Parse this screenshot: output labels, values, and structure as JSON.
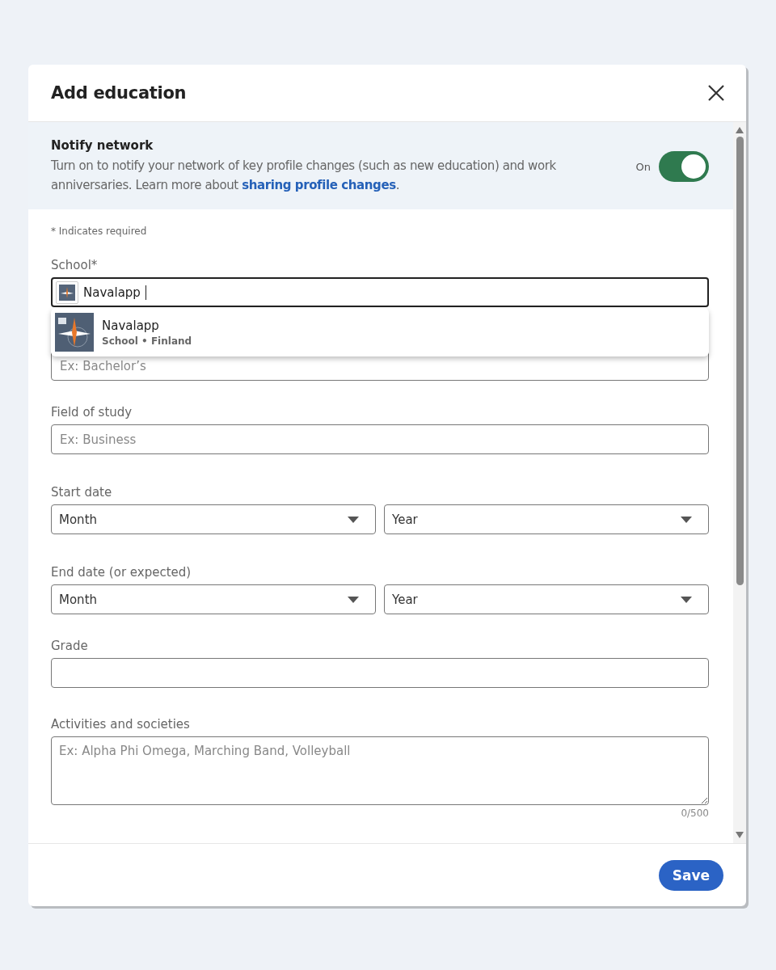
{
  "dialog": {
    "title": "Add education"
  },
  "notify": {
    "title": "Notify network",
    "text": "Turn on to notify your network of key profile changes (such as new education) and work anniversaries. Learn more about ",
    "link": "sharing profile changes",
    "after": ".",
    "toggle_label": "On",
    "on": true
  },
  "required_note": "* Indicates required",
  "fields": [
    {
      "kind": "school",
      "label": "School*",
      "value": "Navalapp"
    },
    {
      "kind": "text",
      "placeholder": "Ex: Bachelor’s"
    },
    {
      "kind": "text",
      "label": "Field of study",
      "placeholder": "Ex: Business"
    },
    {
      "kind": "dates",
      "label": "Start date",
      "selects": [
        "Month",
        "Year"
      ]
    },
    {
      "kind": "dates",
      "label": "End date (or expected)",
      "selects": [
        "Month",
        "Year"
      ]
    },
    {
      "kind": "text",
      "label": "Grade"
    },
    {
      "kind": "textarea",
      "label": "Activities and societies",
      "placeholder": "Ex: Alpha Phi Omega, Marching Band, Volleyball",
      "counter": "0/500"
    }
  ],
  "suggestions": [
    {
      "name": "Navalapp",
      "detail": "School • Finland"
    }
  ],
  "save": "Save"
}
